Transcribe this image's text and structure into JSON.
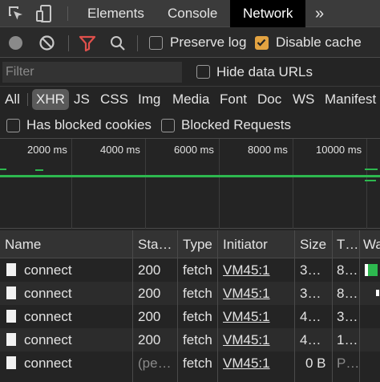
{
  "tabs": {
    "items": [
      "Elements",
      "Console",
      "Network"
    ],
    "active": "Network",
    "overflow": "»"
  },
  "toolbar": {
    "preserve_log": {
      "label": "Preserve log",
      "checked": false
    },
    "disable_cache": {
      "label": "Disable cache",
      "checked": true
    }
  },
  "filter": {
    "placeholder": "Filter",
    "hide_data_urls": {
      "label": "Hide data URLs",
      "checked": false
    }
  },
  "types": {
    "items": [
      "All",
      "XHR",
      "JS",
      "CSS",
      "Img",
      "Media",
      "Font",
      "Doc",
      "WS",
      "Manifest"
    ],
    "selected": "XHR"
  },
  "blocked": {
    "has_blocked_cookies": "Has blocked cookies",
    "blocked_requests": "Blocked Requests"
  },
  "overview": {
    "ticks": [
      "2000 ms",
      "4000 ms",
      "6000 ms",
      "8000 ms",
      "10000 ms"
    ]
  },
  "table": {
    "headers": {
      "name": "Name",
      "status": "Sta…",
      "type": "Type",
      "initiator": "Initiator",
      "size": "Size",
      "time": "T…",
      "waterfall": "Wa"
    },
    "rows": [
      {
        "name": "connect",
        "status": "200",
        "type": "fetch",
        "initiator": "VM45:1",
        "size": "3…",
        "time": "8…"
      },
      {
        "name": "connect",
        "status": "200",
        "type": "fetch",
        "initiator": "VM45:1",
        "size": "3…",
        "time": "8…"
      },
      {
        "name": "connect",
        "status": "200",
        "type": "fetch",
        "initiator": "VM45:1",
        "size": "4…",
        "time": "3…"
      },
      {
        "name": "connect",
        "status": "200",
        "type": "fetch",
        "initiator": "VM45:1",
        "size": "4…",
        "time": "1…"
      },
      {
        "name": "connect",
        "status": "(pe…",
        "type": "fetch",
        "initiator": "VM45:1",
        "size": "0 B",
        "time": "P…"
      }
    ]
  },
  "colors": {
    "accent_checkbox": "#e3a341",
    "filter_icon": "#e0504c",
    "waterfall_green": "#2db84f",
    "active_tab_bg": "#000000"
  }
}
